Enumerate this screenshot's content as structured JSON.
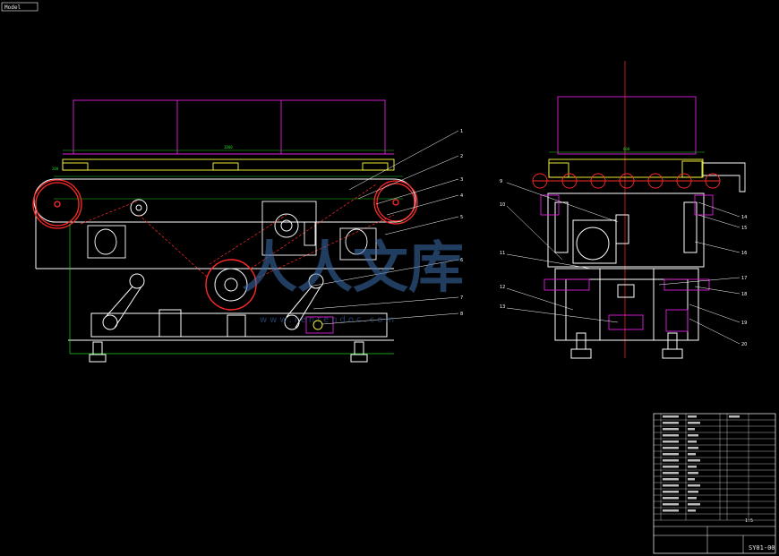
{
  "drawing": {
    "tab_label": "Model",
    "overall_length_dim": "1000",
    "end_view_dim": "600",
    "side_height_dim": "200",
    "drawing_number": "SY01-00",
    "scale_label": "1:5"
  },
  "side_view_callouts": [
    "1",
    "2",
    "3",
    "4",
    "5",
    "6",
    "7",
    "8"
  ],
  "end_view_callouts_left": [
    "9",
    "10",
    "11",
    "12",
    "13"
  ],
  "end_view_callouts_right": [
    "14",
    "15",
    "16",
    "17",
    "18",
    "19",
    "20"
  ],
  "watermark": {
    "text": "人人文库",
    "url": "www.renrendoc.com"
  },
  "colors": {
    "background": "#000000",
    "line_white": "#ffffff",
    "line_red": "#ff2a2a",
    "line_magenta": "#e020e0",
    "line_green": "#20d020",
    "line_yellow": "#ffff40",
    "watermark": "#3d6fb0"
  }
}
